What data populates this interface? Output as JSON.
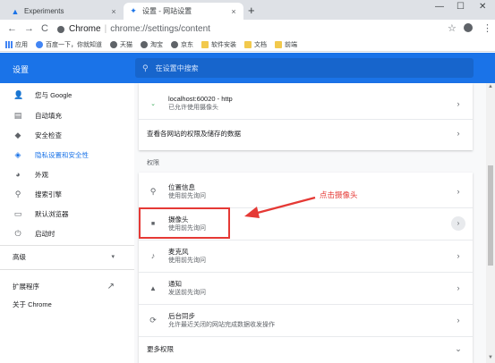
{
  "tabs": [
    {
      "label": "Experiments",
      "icon": "flask-icon",
      "close": "×"
    },
    {
      "label": "设置 - 网站设置",
      "icon": "gear-icon",
      "close": "×"
    }
  ],
  "new_tab": "+",
  "window_controls": {
    "minimize": "—",
    "maximize": "☐",
    "close": "✕"
  },
  "toolbar": {
    "back": "←",
    "forward": "→",
    "reload": "C",
    "site_name": "Chrome",
    "url": "chrome://settings/content",
    "star": "☆",
    "menu": "⋮"
  },
  "bookmarks": [
    {
      "label": "应用",
      "icon": "grid"
    },
    {
      "label": "百度一下，你就知道",
      "icon": "paw"
    },
    {
      "label": "天猫",
      "icon": "globe"
    },
    {
      "label": "淘宝",
      "icon": "globe"
    },
    {
      "label": "京东",
      "icon": "globe"
    },
    {
      "label": "软件安装",
      "icon": "folder"
    },
    {
      "label": "文档",
      "icon": "folder"
    },
    {
      "label": "前端",
      "icon": "folder"
    }
  ],
  "header": {
    "title": "设置",
    "search_placeholder": "在设置中搜索"
  },
  "sidebar": {
    "items": [
      {
        "label": "您与 Google",
        "icon": "person-icon",
        "glyph": "👤"
      },
      {
        "label": "自动填充",
        "icon": "clipboard-icon",
        "glyph": "▤"
      },
      {
        "label": "安全检查",
        "icon": "shield-check-icon",
        "glyph": "◆"
      },
      {
        "label": "隐私设置和安全性",
        "icon": "shield-icon",
        "glyph": "◈"
      },
      {
        "label": "外观",
        "icon": "palette-icon",
        "glyph": "◕"
      },
      {
        "label": "搜索引擎",
        "icon": "search-icon",
        "glyph": "⚲"
      },
      {
        "label": "默认浏览器",
        "icon": "browser-icon",
        "glyph": "▭"
      },
      {
        "label": "启动时",
        "icon": "power-icon",
        "glyph": "⏻"
      }
    ],
    "advanced": {
      "label": "高级",
      "chevron": "▾"
    },
    "extensions": {
      "label": "扩展程序",
      "icon": "open-external-icon",
      "glyph": "↗"
    },
    "about": {
      "label": "关于 Chrome"
    }
  },
  "main": {
    "site_row": {
      "title": "localhost:60020 - http",
      "subtitle": "已允许使用摄像头"
    },
    "view_permissions": "查看各网站的权限及储存的数据",
    "section_label": "权限",
    "permissions": [
      {
        "title": "位置信息",
        "subtitle": "使用前先询问",
        "icon": "location-icon",
        "glyph": "📍"
      },
      {
        "title": "摄像头",
        "subtitle": "使用前先询问",
        "icon": "camera-icon",
        "glyph": "■"
      },
      {
        "title": "麦克风",
        "subtitle": "使用前先询问",
        "icon": "microphone-icon",
        "glyph": "🎤"
      },
      {
        "title": "通知",
        "subtitle": "发送前先询问",
        "icon": "bell-icon",
        "glyph": "🔔"
      },
      {
        "title": "后台同步",
        "subtitle": "允许最近关闭的网站完成数据收发操作",
        "icon": "sync-icon",
        "glyph": "⟳"
      }
    ],
    "more_permissions": "更多权限",
    "arrow": "›",
    "expand": "⌄"
  },
  "annotation": {
    "text": "点击摄像头",
    "color": "#e53935"
  },
  "colors": {
    "accent": "#1a73e8",
    "annotation": "#e53935"
  }
}
